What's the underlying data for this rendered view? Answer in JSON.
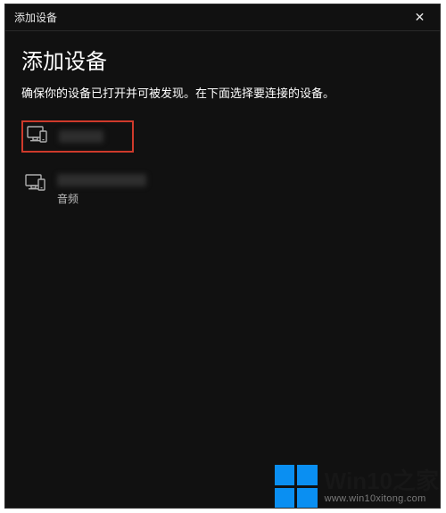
{
  "titlebar": {
    "title": "添加设备",
    "close_glyph": "✕"
  },
  "heading": "添加设备",
  "subheading": "确保你的设备已打开并可被发现。在下面选择要连接的设备。",
  "devices": [
    {
      "name": "",
      "subtitle": ""
    },
    {
      "name": "",
      "subtitle": "音频"
    }
  ],
  "watermark": {
    "title": "Win10之家",
    "url": "www.win10xitong.com"
  }
}
